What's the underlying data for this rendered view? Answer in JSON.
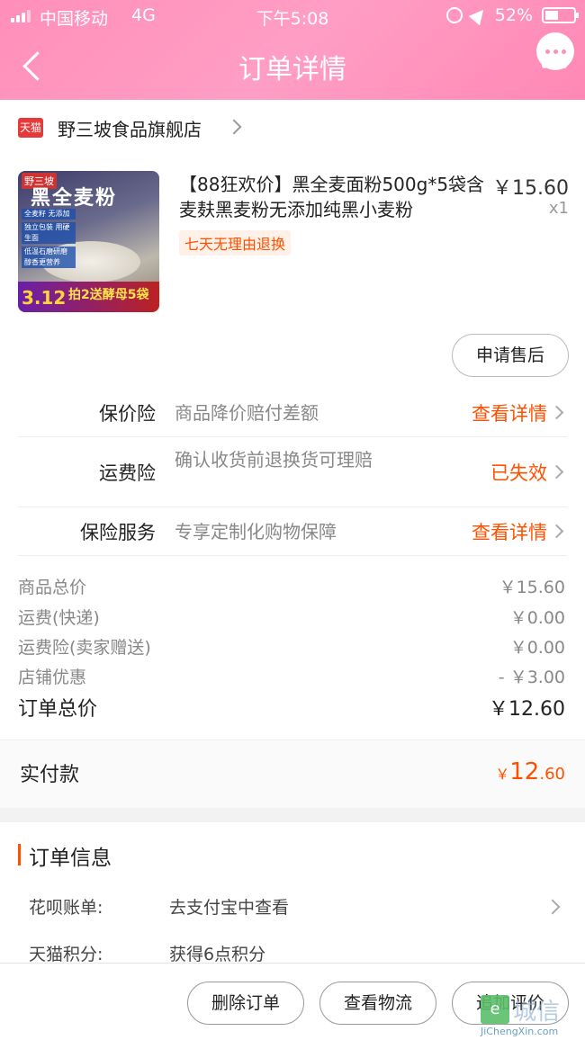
{
  "status_bar": {
    "carrier": "中国移动",
    "network": "4G",
    "time": "下午5:08",
    "battery": "52%"
  },
  "header": {
    "title": "订单详情"
  },
  "shop": {
    "badge": "天猫",
    "name": "野三坡食品旗舰店"
  },
  "product": {
    "image": {
      "brand": "野三坡",
      "headline": "黑全麦粉",
      "tags": [
        "全麦籽 无添加",
        "独立包装 用硬生面",
        "低温石磨研磨 醇香更营养"
      ],
      "price_badge": "3.12",
      "promo": "拍2送酵母5袋"
    },
    "title": "【88狂欢价】黑全麦面粉500g*5袋含麦麸黑麦粉无添加纯黑小麦粉",
    "price": "￥15.60",
    "quantity": "x1",
    "return_tag": "七天无理由退换",
    "after_sale_label": "申请售后"
  },
  "insurance": [
    {
      "label": "保价险",
      "desc": "商品降价赔付差额",
      "action": "查看详情",
      "action_color": "#ff5000"
    },
    {
      "label": "运费险",
      "desc": "确认收货前退换货可理赔",
      "action": "已失效",
      "action_color": "#ff5000"
    },
    {
      "label": "保险服务",
      "desc": "专享定制化购物保障",
      "action": "查看详情",
      "action_color": "#ff5000"
    }
  ],
  "summary": [
    {
      "label": "商品总价",
      "value": "￥15.60"
    },
    {
      "label": "运费(快递)",
      "value": "￥0.00"
    },
    {
      "label": "运费险(卖家赠送)",
      "value": "￥0.00"
    },
    {
      "label": "店铺优惠",
      "value": "- ￥3.00"
    }
  ],
  "order_total": {
    "label": "订单总价",
    "value": "￥12.60"
  },
  "paid": {
    "label": "实付款",
    "currency": "￥",
    "integer": "12",
    "decimal": ".60"
  },
  "order_info": {
    "title": "订单信息",
    "rows": [
      {
        "label": "花呗账单:",
        "value": "去支付宝中查看"
      },
      {
        "label": "天猫积分:",
        "value": "获得6点积分"
      }
    ]
  },
  "bottom_bar": {
    "delete_label": "删除订单",
    "logistics_label": "查看物流",
    "review_label": "追加评价"
  },
  "watermark": {
    "logo": "e",
    "text": "城信",
    "url": "JiChengXin.com"
  },
  "colors": {
    "header_pink": "#ff8fb8",
    "accent_orange": "#ff5000"
  }
}
